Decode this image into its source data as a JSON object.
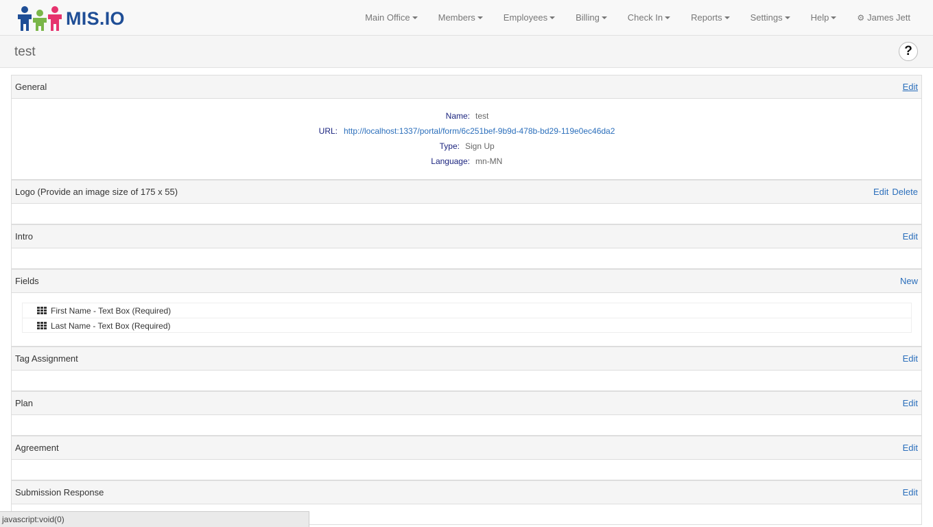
{
  "app": {
    "logo_text": "MIS.IO"
  },
  "nav": {
    "items": [
      "Main Office",
      "Members",
      "Employees",
      "Billing",
      "Check In",
      "Reports",
      "Settings",
      "Help"
    ],
    "user": "James Jett"
  },
  "page": {
    "title": "test"
  },
  "sections": {
    "general": {
      "title": "General",
      "edit_label": "Edit",
      "fields": {
        "name_label": "Name:",
        "name_value": "test",
        "url_label": "URL:",
        "url_value": "http://localhost:1337/portal/form/6c251bef-9b9d-478b-bd29-119e0ec46da2",
        "type_label": "Type:",
        "type_value": "Sign Up",
        "language_label": "Language:",
        "language_value": "mn-MN"
      }
    },
    "logo": {
      "title": "Logo (Provide an image size of 175 x 55)",
      "edit_label": "Edit",
      "delete_label": "Delete"
    },
    "intro": {
      "title": "Intro",
      "edit_label": "Edit"
    },
    "fields": {
      "title": "Fields",
      "new_label": "New",
      "items": [
        "First Name - Text Box (Required)",
        "Last Name - Text Box (Required)"
      ]
    },
    "tag_assignment": {
      "title": "Tag Assignment",
      "edit_label": "Edit"
    },
    "plan": {
      "title": "Plan",
      "edit_label": "Edit"
    },
    "agreement": {
      "title": "Agreement",
      "edit_label": "Edit"
    },
    "submission_response": {
      "title": "Submission Response",
      "edit_label": "Edit"
    }
  },
  "statusbar": {
    "text": "javascript:void(0)"
  },
  "colors": {
    "brand": "#1f4e96",
    "link": "#2a6ebb",
    "label": "#1a237e"
  },
  "icons": {
    "help": "question-icon",
    "user": "gear-icon",
    "field": "grid-icon"
  }
}
